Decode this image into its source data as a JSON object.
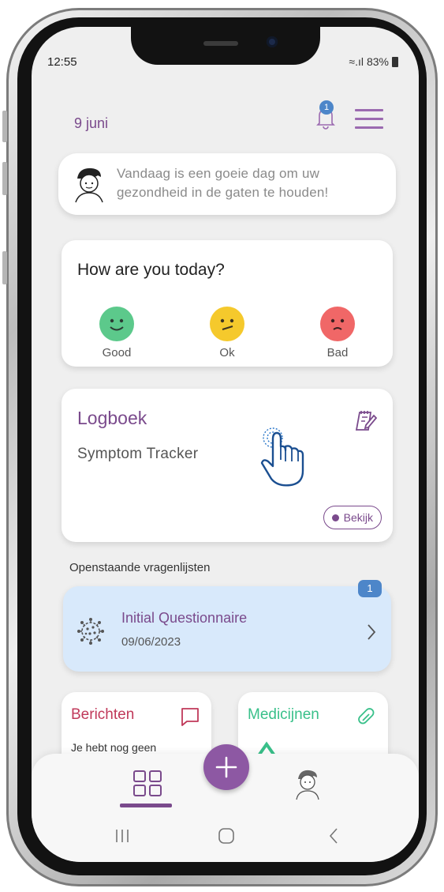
{
  "status_bar": {
    "time": "12:55",
    "battery": "83%"
  },
  "header": {
    "date": "9 juni",
    "notification_count": "1"
  },
  "greeting": {
    "text": "Vandaag is een goeie dag om uw gezondheid in de gaten te houden!"
  },
  "mood": {
    "title": "How are you today?",
    "options": [
      {
        "label": "Good",
        "color": "#5cc98b"
      },
      {
        "label": "Ok",
        "color": "#f5c92c"
      },
      {
        "label": "Bad",
        "color": "#f06767"
      }
    ]
  },
  "logboek": {
    "title": "Logboek",
    "subtitle": "Symptom Tracker",
    "button": "Bekijk"
  },
  "questionnaires": {
    "section_label": "Openstaande vragenlijsten",
    "items": [
      {
        "title": "Initial Questionnaire",
        "date": "09/06/2023",
        "badge": "1"
      }
    ]
  },
  "tiles": {
    "berichten": {
      "title": "Berichten",
      "text": "Je hebt nog geen",
      "color": "#c0395a"
    },
    "medicijnen": {
      "title": "Medicijnen",
      "color": "#39c08a"
    }
  },
  "colors": {
    "accent": "#7a4a8c",
    "badge": "#4d86c9",
    "questionnaire_bg": "#d8e9fb"
  },
  "icons": [
    "bell-icon",
    "menu-icon",
    "notes-edit-icon",
    "hand-tap-icon",
    "virus-icon",
    "chevron-right-icon",
    "chat-icon",
    "pill-icon",
    "grid-icon",
    "plus-icon",
    "profile-icon"
  ]
}
